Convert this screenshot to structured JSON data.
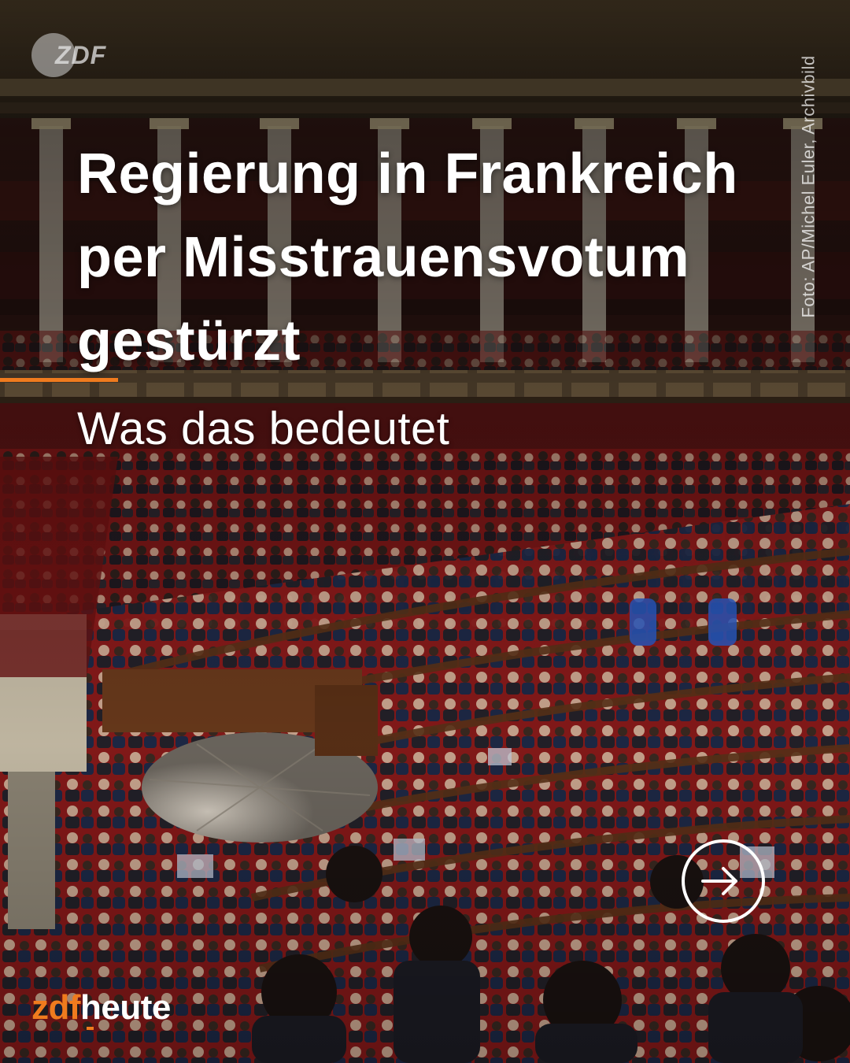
{
  "watermark": {
    "text": "ZDF",
    "icon": "zdf-disc-icon"
  },
  "headline": {
    "line1": "Regierung in Frankreich",
    "line2": "per Misstrauensvotum",
    "line3": "gestürzt"
  },
  "subline": "Was das bedeutet",
  "credit": "Foto: AP/Michel Euler, Archivbild",
  "next_button": {
    "icon": "arrow-right-circle-icon"
  },
  "logo": {
    "part1": "zdf",
    "part2": "heute"
  },
  "colors": {
    "accent": "#f07b1e",
    "text": "#ffffff",
    "seat_red": "#9b1c1c",
    "wood": "#5a3218"
  }
}
